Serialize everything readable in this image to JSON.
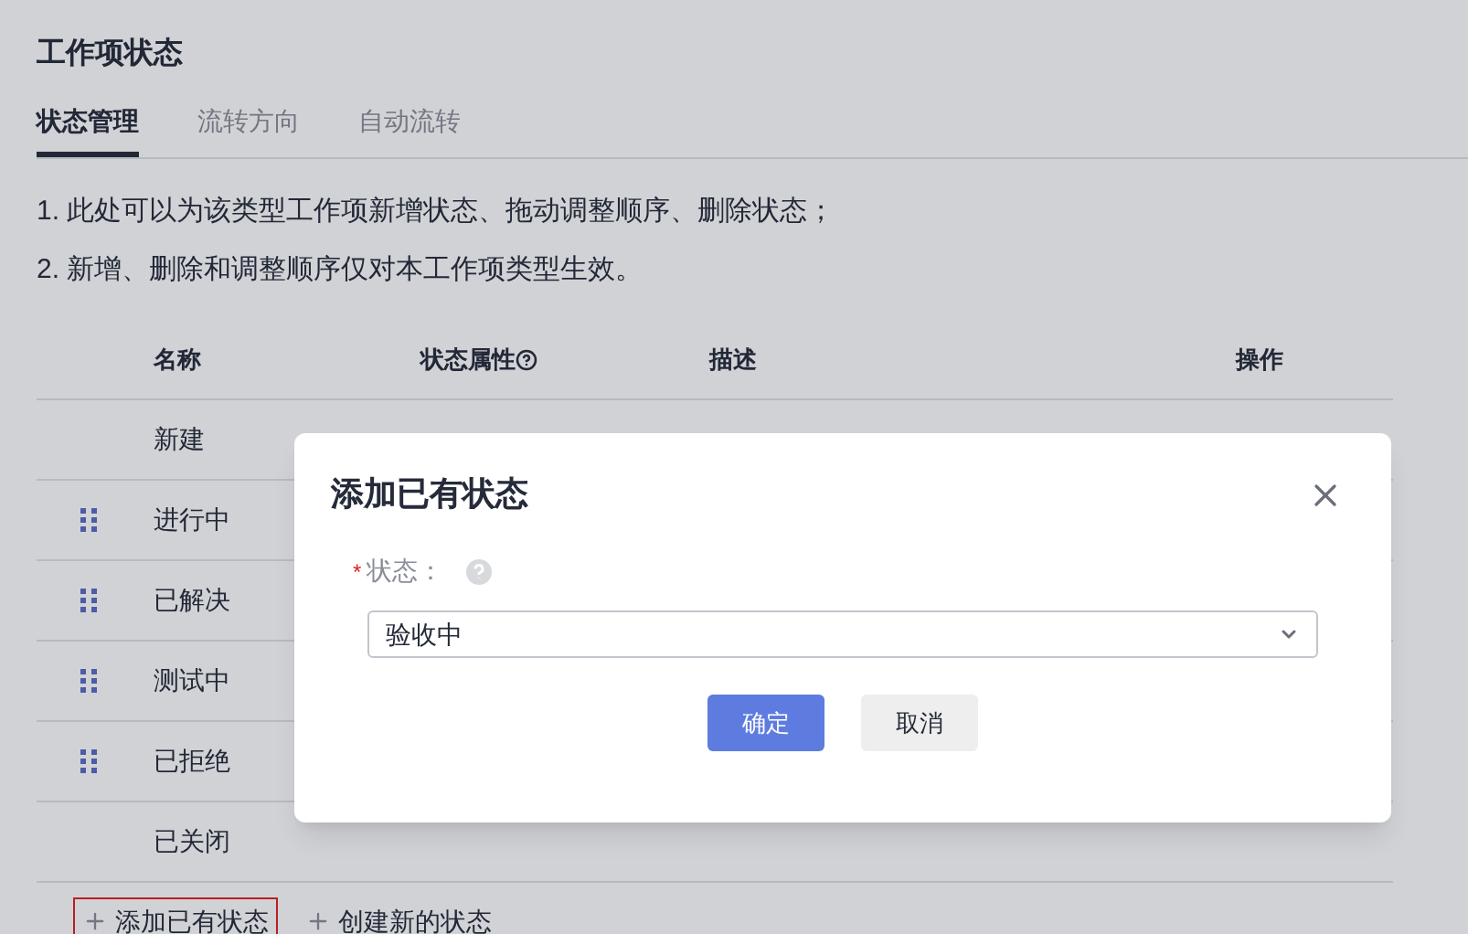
{
  "page": {
    "title": "工作项状态"
  },
  "tabs": [
    {
      "label": "状态管理",
      "selected": true
    },
    {
      "label": "流转方向",
      "selected": false
    },
    {
      "label": "自动流转",
      "selected": false
    }
  ],
  "notes": [
    "1. 此处可以为该类型工作项新增状态、拖动调整顺序、删除状态；",
    "2. 新增、删除和调整顺序仅对本工作项类型生效。"
  ],
  "table": {
    "columns": [
      "名称",
      "状态属性",
      "描述",
      "操作"
    ],
    "rows": [
      {
        "name": "新建",
        "draggable": false
      },
      {
        "name": "进行中",
        "draggable": true
      },
      {
        "name": "已解决",
        "draggable": true
      },
      {
        "name": "测试中",
        "draggable": true
      },
      {
        "name": "已拒绝",
        "draggable": true
      },
      {
        "name": "已关闭",
        "draggable": false
      }
    ]
  },
  "actions": [
    {
      "label": "添加已有状态",
      "highlighted": true
    },
    {
      "label": "创建新的状态",
      "highlighted": false
    }
  ],
  "dialog": {
    "title": "添加已有状态",
    "field_label": "状态：",
    "required_mark": "*",
    "value": "验收中",
    "buttons": [
      {
        "label": "确定",
        "kind": "primary"
      },
      {
        "label": "取消",
        "kind": "secondary"
      }
    ]
  }
}
